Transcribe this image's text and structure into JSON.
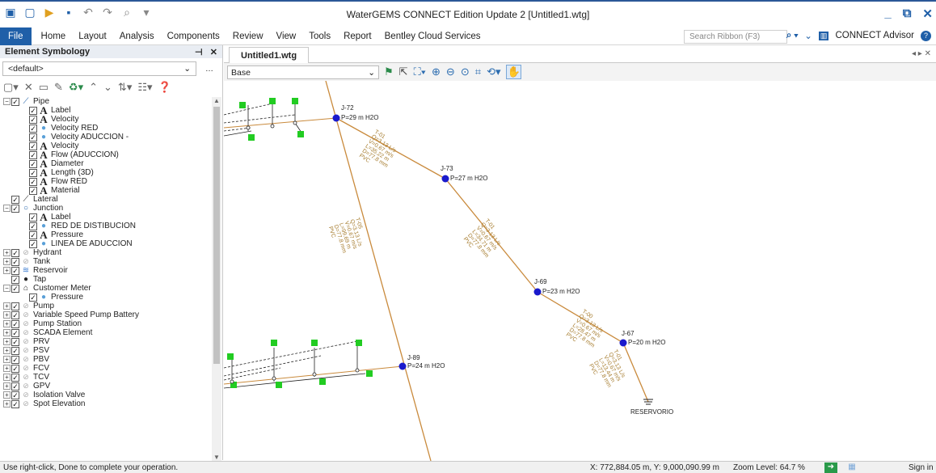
{
  "app": {
    "title": "WaterGEMS CONNECT Edition Update 2 [Untitled1.wtg]"
  },
  "ribbon": {
    "tabs": [
      "File",
      "Home",
      "Layout",
      "Analysis",
      "Components",
      "Review",
      "View",
      "Tools",
      "Report",
      "Bentley Cloud Services"
    ],
    "search_placeholder": "Search Ribbon (F3)",
    "advisor": "CONNECT Advisor"
  },
  "element_symbology": {
    "title": "Element Symbology",
    "dropdown_value": "<default>",
    "tree": [
      {
        "label": "Pipe",
        "indent": 0,
        "exp": "-",
        "checked": true,
        "icon": "pipe"
      },
      {
        "label": "Label",
        "indent": 1,
        "checked": true,
        "icon": "A"
      },
      {
        "label": "Velocity",
        "indent": 1,
        "checked": true,
        "icon": "A"
      },
      {
        "label": "Velocity RED",
        "indent": 1,
        "checked": true,
        "icon": "color"
      },
      {
        "label": "Velocity ADUCCION -",
        "indent": 1,
        "checked": true,
        "icon": "color"
      },
      {
        "label": "Velocity",
        "indent": 1,
        "checked": true,
        "icon": "A"
      },
      {
        "label": "Flow (ADUCCION)",
        "indent": 1,
        "checked": true,
        "icon": "A"
      },
      {
        "label": "Diameter",
        "indent": 1,
        "checked": true,
        "icon": "A"
      },
      {
        "label": "Length (3D)",
        "indent": 1,
        "checked": true,
        "icon": "A"
      },
      {
        "label": "Flow RED",
        "indent": 1,
        "checked": true,
        "icon": "A"
      },
      {
        "label": "Material",
        "indent": 1,
        "checked": true,
        "icon": "A"
      },
      {
        "label": "Lateral",
        "indent": 0,
        "checked": true,
        "icon": "lateral"
      },
      {
        "label": "Junction",
        "indent": 0,
        "exp": "-",
        "checked": true,
        "icon": "junction"
      },
      {
        "label": "Label",
        "indent": 1,
        "checked": true,
        "icon": "A"
      },
      {
        "label": "RED DE DISTIBUCION",
        "indent": 1,
        "checked": true,
        "icon": "color"
      },
      {
        "label": "Pressure",
        "indent": 1,
        "checked": true,
        "icon": "A"
      },
      {
        "label": "LINEA DE ADUCCION",
        "indent": 1,
        "checked": true,
        "icon": "color"
      },
      {
        "label": "Hydrant",
        "indent": 0,
        "exp": "+",
        "checked": true,
        "icon": "dim"
      },
      {
        "label": "Tank",
        "indent": 0,
        "exp": "+",
        "checked": true,
        "icon": "dim"
      },
      {
        "label": "Reservoir",
        "indent": 0,
        "exp": "+",
        "checked": true,
        "icon": "reservoir"
      },
      {
        "label": "Tap",
        "indent": 0,
        "checked": true,
        "icon": "tap"
      },
      {
        "label": "Customer Meter",
        "indent": 0,
        "exp": "-",
        "checked": true,
        "icon": "meter"
      },
      {
        "label": "Pressure",
        "indent": 1,
        "checked": true,
        "icon": "color"
      },
      {
        "label": "Pump",
        "indent": 0,
        "exp": "+",
        "checked": true,
        "icon": "dim"
      },
      {
        "label": "Variable Speed Pump Battery",
        "indent": 0,
        "exp": "+",
        "checked": true,
        "icon": "dim"
      },
      {
        "label": "Pump Station",
        "indent": 0,
        "exp": "+",
        "checked": true,
        "icon": "dim"
      },
      {
        "label": "SCADA Element",
        "indent": 0,
        "exp": "+",
        "checked": true,
        "icon": "dim"
      },
      {
        "label": "PRV",
        "indent": 0,
        "exp": "+",
        "checked": true,
        "icon": "dim"
      },
      {
        "label": "PSV",
        "indent": 0,
        "exp": "+",
        "checked": true,
        "icon": "dim"
      },
      {
        "label": "PBV",
        "indent": 0,
        "exp": "+",
        "checked": true,
        "icon": "dim"
      },
      {
        "label": "FCV",
        "indent": 0,
        "exp": "+",
        "checked": true,
        "icon": "dim"
      },
      {
        "label": "TCV",
        "indent": 0,
        "exp": "+",
        "checked": true,
        "icon": "dim"
      },
      {
        "label": "GPV",
        "indent": 0,
        "exp": "+",
        "checked": true,
        "icon": "dim"
      },
      {
        "label": "Isolation Valve",
        "indent": 0,
        "exp": "+",
        "checked": true,
        "icon": "dim"
      },
      {
        "label": "Spot Elevation",
        "indent": 0,
        "exp": "+",
        "checked": true,
        "icon": "dim"
      }
    ]
  },
  "drawing": {
    "tab": "Untitled1.wtg",
    "scenario": "Base",
    "junctions": [
      {
        "id": "J-72",
        "label": "J-72",
        "pressure": "P=29 m H2O"
      },
      {
        "id": "J-73",
        "label": "J-73",
        "pressure": "P=27 m H2O"
      },
      {
        "id": "J-69",
        "label": "J-69",
        "pressure": "P=23 m H2O"
      },
      {
        "id": "J-67",
        "label": "J-67",
        "pressure": "P=20 m H2O"
      },
      {
        "id": "J-89",
        "label": "J-89",
        "pressure": "P=24 m H2O"
      }
    ],
    "pipes": [
      {
        "label": "T-01",
        "flow": "Q=3.13 L/s",
        "velocity": "V=0.67 m/s",
        "length": "L=35.22 m",
        "diameter": "D=77.8 mm",
        "material": "PVC"
      },
      {
        "label": "T-01",
        "flow": "Q=3.13 L/s",
        "velocity": "V=0.67 m/s",
        "length": "L=34.71 m",
        "diameter": "D=77.8 mm",
        "material": "PVC"
      },
      {
        "label": "T-00",
        "flow": "Q=3.13 L/s",
        "velocity": "V=0.67 m/s",
        "length": "L=28.47 m",
        "diameter": "D=77.8 mm",
        "material": "PVC"
      },
      {
        "label": "T-01",
        "flow": "Q=3.13 L/s",
        "velocity": "V=0.67 m/s",
        "length": "L=13.44 m",
        "diameter": "D=77.8 mm",
        "material": "PVC"
      },
      {
        "label": "T-05",
        "flow": "Q=3.13 L/s",
        "velocity": "V=0.67 m/s",
        "length": "L=99.69 m",
        "diameter": "D=77.8 mm",
        "material": "PVC"
      }
    ],
    "reservoir": "RESERVORIO",
    "colors": {
      "junction": "#1a1acc",
      "pipe": "#c98a3c",
      "customer_node": "#22cc22",
      "branch": "#222222",
      "label": "#a67c2e"
    }
  },
  "status": {
    "message": "Use right-click, Done to complete your operation.",
    "coordinates": "X: 772,884.05 m, Y: 9,000,090.99 m",
    "zoom": "Zoom Level: 64.7 %",
    "sign_in": "Sign in"
  }
}
